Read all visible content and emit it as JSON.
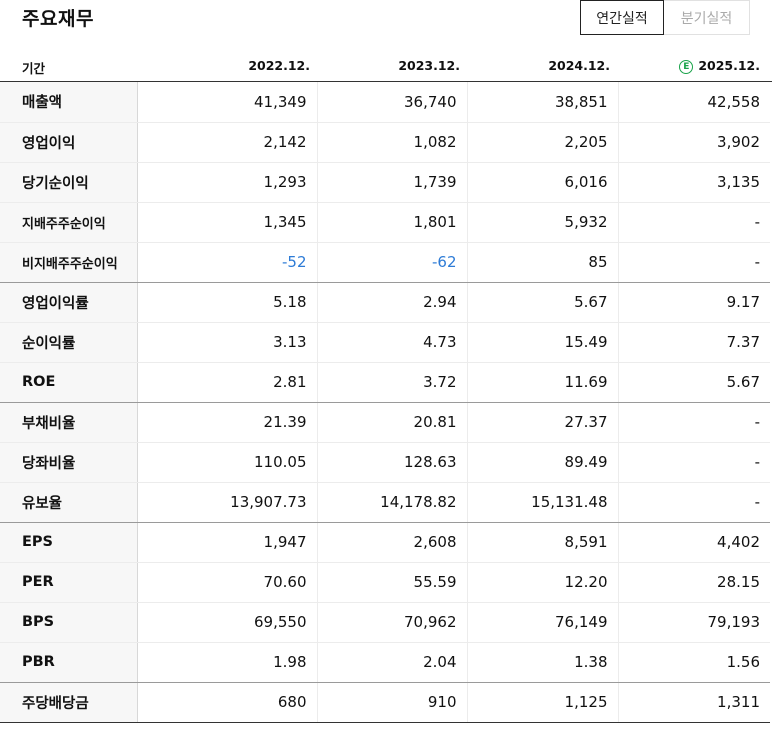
{
  "title": "주요재무",
  "tabs": [
    {
      "label": "연간실적",
      "active": true
    },
    {
      "label": "분기실적",
      "active": false
    }
  ],
  "header": {
    "label": "기간",
    "periods": [
      "2022.12.",
      "2023.12.",
      "2024.12.",
      "2025.12."
    ],
    "estimate_badge": "E"
  },
  "colors": {
    "negative": "#2d7bd6",
    "estimate_badge": "#1aa34a"
  },
  "rows": [
    {
      "label": "매출액",
      "values": [
        "41,349",
        "36,740",
        "38,851",
        "42,558"
      ]
    },
    {
      "label": "영업이익",
      "values": [
        "2,142",
        "1,082",
        "2,205",
        "3,902"
      ]
    },
    {
      "label": "당기순이익",
      "values": [
        "1,293",
        "1,739",
        "6,016",
        "3,135"
      ]
    },
    {
      "label": "지배주주순이익",
      "values": [
        "1,345",
        "1,801",
        "5,932",
        "-"
      ]
    },
    {
      "label": "비지배주주순이익",
      "values": [
        "-52",
        "-62",
        "85",
        "-"
      ]
    },
    {
      "label": "영업이익률",
      "values": [
        "5.18",
        "2.94",
        "5.67",
        "9.17"
      ]
    },
    {
      "label": "순이익률",
      "values": [
        "3.13",
        "4.73",
        "15.49",
        "7.37"
      ]
    },
    {
      "label": "ROE",
      "values": [
        "2.81",
        "3.72",
        "11.69",
        "5.67"
      ]
    },
    {
      "label": "부채비율",
      "values": [
        "21.39",
        "20.81",
        "27.37",
        "-"
      ]
    },
    {
      "label": "당좌비율",
      "values": [
        "110.05",
        "128.63",
        "89.49",
        "-"
      ]
    },
    {
      "label": "유보율",
      "values": [
        "13,907.73",
        "14,178.82",
        "15,131.48",
        "-"
      ]
    },
    {
      "label": "EPS",
      "values": [
        "1,947",
        "2,608",
        "8,591",
        "4,402"
      ]
    },
    {
      "label": "PER",
      "values": [
        "70.60",
        "55.59",
        "12.20",
        "28.15"
      ]
    },
    {
      "label": "BPS",
      "values": [
        "69,550",
        "70,962",
        "76,149",
        "79,193"
      ]
    },
    {
      "label": "PBR",
      "values": [
        "1.98",
        "2.04",
        "1.38",
        "1.56"
      ]
    },
    {
      "label": "주당배당금",
      "values": [
        "680",
        "910",
        "1,125",
        "1,311"
      ]
    }
  ]
}
